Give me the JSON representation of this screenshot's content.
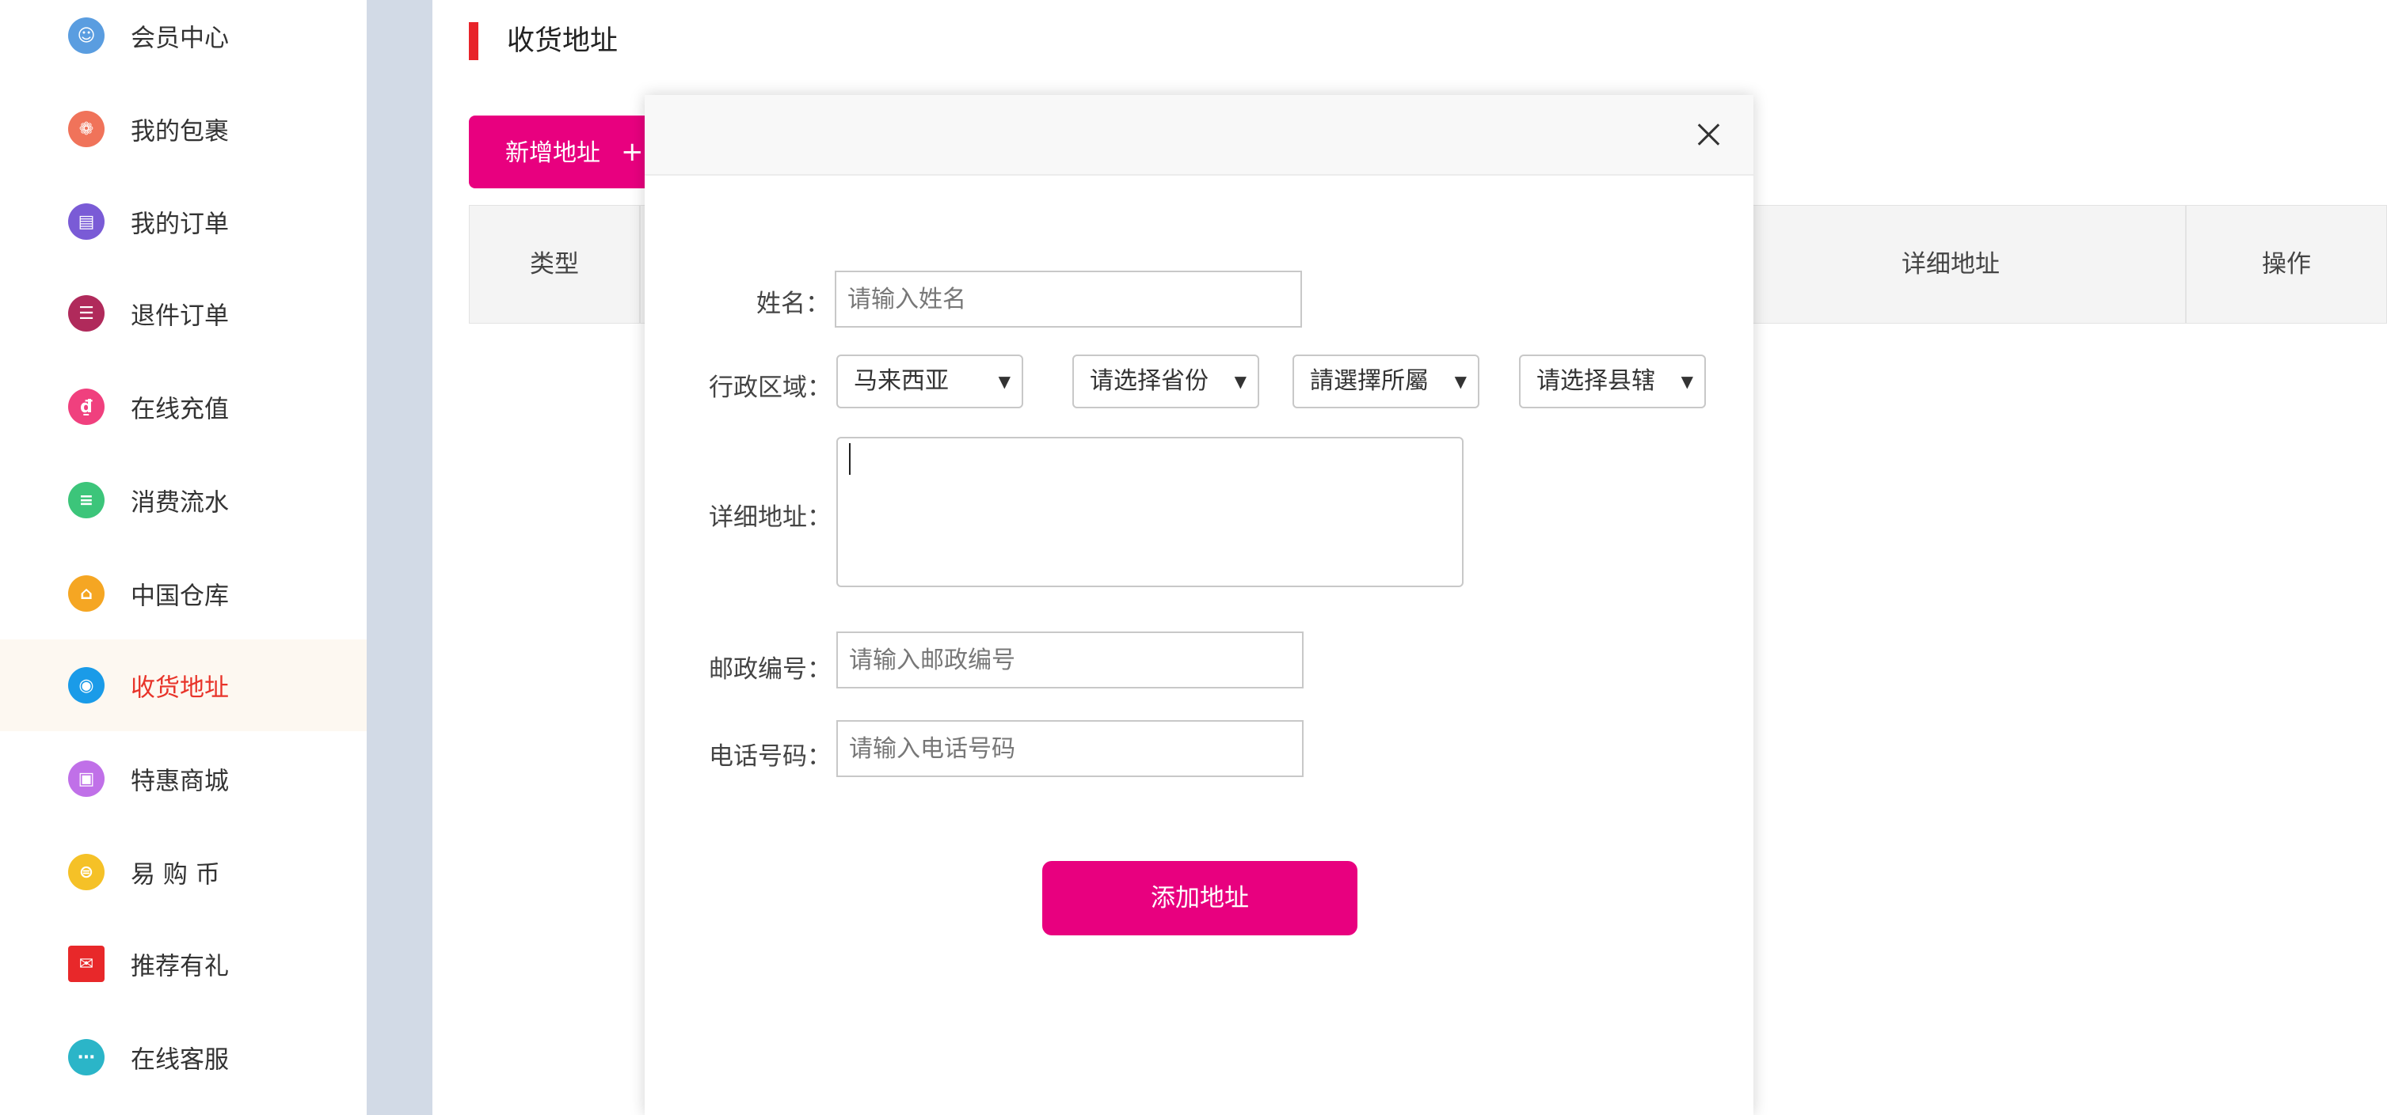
{
  "sidebar": {
    "items": [
      {
        "label": "会员中心",
        "icon": "avatar-icon",
        "color": "#5a9de0",
        "active": false
      },
      {
        "label": "我的包裹",
        "icon": "package-icon",
        "color": "#f0735a",
        "active": false
      },
      {
        "label": "我的订单",
        "icon": "order-icon",
        "color": "#7a5bd6",
        "active": false
      },
      {
        "label": "退件订单",
        "icon": "return-icon",
        "color": "#b02a5b",
        "active": false
      },
      {
        "label": "在线充值",
        "icon": "moneybag-icon",
        "color": "#f0407e",
        "active": false
      },
      {
        "label": "消费流水",
        "icon": "ledger-icon",
        "color": "#3cc57a",
        "active": false
      },
      {
        "label": "中国仓库",
        "icon": "warehouse-icon",
        "color": "#f5a623",
        "active": false
      },
      {
        "label": "收货地址",
        "icon": "location-icon",
        "color": "#1a9be8",
        "active": true
      },
      {
        "label": "特惠商城",
        "icon": "mall-icon",
        "color": "#c070e8",
        "active": false
      },
      {
        "label": "易 购 币",
        "icon": "coin-icon",
        "color": "#f5c127",
        "active": false
      },
      {
        "label": "推荐有礼",
        "icon": "gift-envelope-icon",
        "color": "#e8282a",
        "active": false
      },
      {
        "label": "在线客服",
        "icon": "chat-icon",
        "color": "#2bb5c8",
        "active": false
      }
    ]
  },
  "page": {
    "title": "收货地址",
    "add_button": "新增地址",
    "add_plus": "+"
  },
  "table": {
    "headers": [
      "类型",
      "详细地址",
      "操作"
    ]
  },
  "modal": {
    "name_label": "姓名：",
    "name_placeholder": "请输入姓名",
    "region_label": "行政区域：",
    "country_value": "马来西亚",
    "province_value": "请选择省份",
    "city_value": "請選擇所屬",
    "county_value": "请选择县辖",
    "address_label": "详细地址：",
    "address_value": "",
    "postal_label": "邮政编号：",
    "postal_placeholder": "请输入邮政编号",
    "phone_label": "电话号码：",
    "phone_placeholder": "请输入电话号码",
    "submit_label": "添加地址"
  },
  "colors": {
    "accent": "#e8007f",
    "active_text": "#e8342a",
    "gutter": "#d2dae6"
  }
}
